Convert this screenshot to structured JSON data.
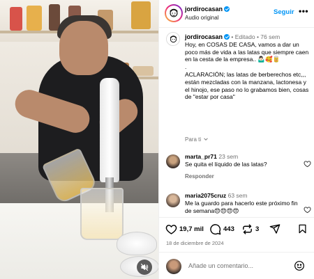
{
  "post": {
    "author": "jordirocasan",
    "audio": "Audio original",
    "follow_label": "Seguir",
    "more_label": "•••",
    "caption": {
      "author": "jordirocasan",
      "edited": "• Editado",
      "age": "• 76 sem",
      "text": "Hoy, en COSAS DE CASA, vamos a dar un poco más de vida a las latas que siempre caen en la cesta de la empresa.. 🤷🏻‍♂️🥰🥫",
      "dot": ".",
      "clarification": "ACLARACIÓN; las latas de berberechos etc,,, están mezcladas con la manzana, lactonesa y el hinojo, ese paso no lo grabamos bien, cosas de \"estar por casa\""
    },
    "translate_label": "Para ti",
    "comments": [
      {
        "user": "marta_pr71",
        "time": "23 sem",
        "text": "Se quita el líquido de las latas?",
        "reply_label": "Responder"
      },
      {
        "user": "maria2075cruz",
        "time": "63 sem",
        "text": "Me la guardo para hacerlo este próximo fin de semana😍😍😍😍"
      }
    ],
    "stats": {
      "likes": "19,7 mil",
      "comments": "443",
      "reposts": "3"
    },
    "date": "18 de diciembre de 2024",
    "add_comment_placeholder": "Añade un comentario..."
  },
  "colors": {
    "link": "#0095f6",
    "muted": "#737373"
  },
  "icons": [
    "mute-icon",
    "verified-icon",
    "more-icon",
    "chevron-down-icon",
    "heart-icon",
    "comment-icon",
    "repost-icon",
    "share-icon",
    "bookmark-icon",
    "emoji-icon"
  ]
}
